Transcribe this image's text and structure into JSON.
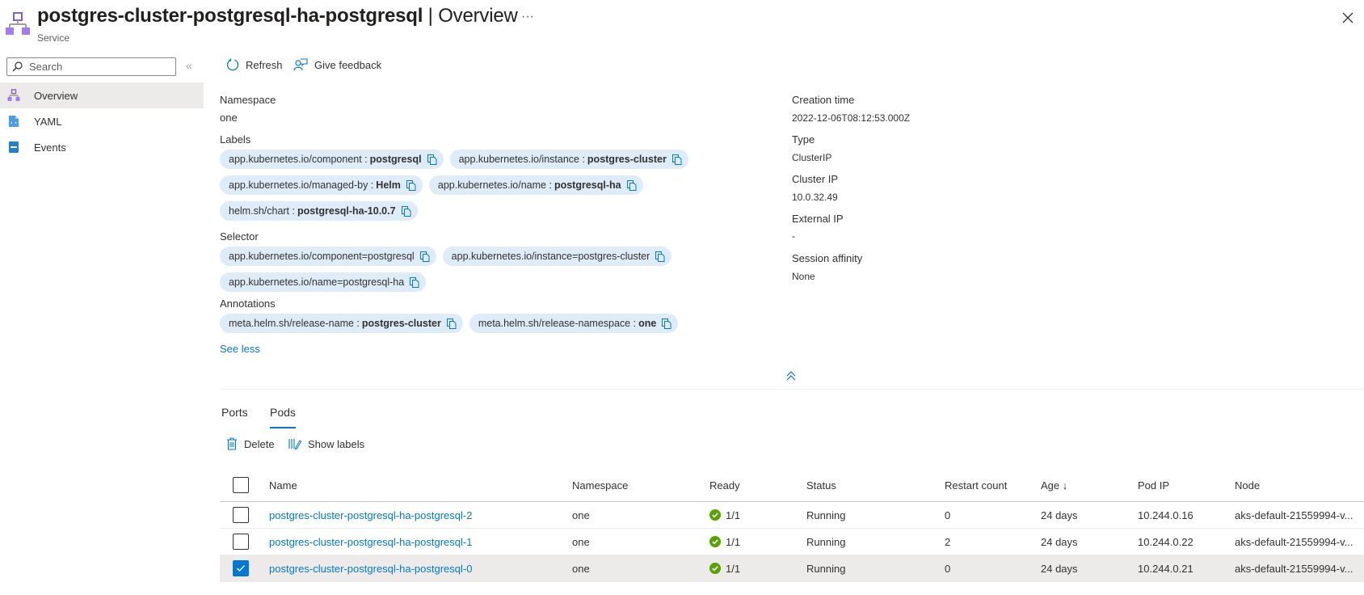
{
  "header": {
    "title": "postgres-cluster-postgresql-ha-postgresql",
    "separator": " | ",
    "section": "Overview",
    "subtitle": "Service",
    "more_label": "···",
    "icon": "service-icon"
  },
  "sidebar": {
    "search_placeholder": "Search",
    "collapse_label": "«",
    "items": [
      {
        "label": "Overview",
        "icon": "service-icon",
        "active": true
      },
      {
        "label": "YAML",
        "icon": "yaml-file-icon",
        "active": false
      },
      {
        "label": "Events",
        "icon": "events-icon",
        "active": false
      }
    ]
  },
  "toolbar": {
    "refresh_label": "Refresh",
    "feedback_label": "Give feedback"
  },
  "properties": {
    "namespace_label": "Namespace",
    "namespace_value": "one",
    "labels_label": "Labels",
    "labels": [
      {
        "key": "app.kubernetes.io/component :",
        "value": "postgresql"
      },
      {
        "key": "app.kubernetes.io/instance :",
        "value": "postgres-cluster"
      },
      {
        "key": "app.kubernetes.io/managed-by :",
        "value": "Helm"
      },
      {
        "key": "app.kubernetes.io/name :",
        "value": "postgresql-ha"
      },
      {
        "key": "helm.sh/chart :",
        "value": "postgresql-ha-10.0.7"
      }
    ],
    "selector_label": "Selector",
    "selectors": [
      "app.kubernetes.io/component=postgresql",
      "app.kubernetes.io/instance=postgres-cluster",
      "app.kubernetes.io/name=postgresql-ha"
    ],
    "annotations_label": "Annotations",
    "annotations": [
      {
        "key": "meta.helm.sh/release-name :",
        "value": "postgres-cluster"
      },
      {
        "key": "meta.helm.sh/release-namespace :",
        "value": "one"
      }
    ],
    "see_less_label": "See less",
    "creation_time_label": "Creation time",
    "creation_time_value": "2022-12-06T08:12:53.000Z",
    "type_label": "Type",
    "type_value": "ClusterIP",
    "cluster_ip_label": "Cluster IP",
    "cluster_ip_value": "10.0.32.49",
    "external_ip_label": "External IP",
    "external_ip_value": "-",
    "session_affinity_label": "Session affinity",
    "session_affinity_value": "None"
  },
  "tabs": [
    {
      "label": "Ports",
      "active": false
    },
    {
      "label": "Pods",
      "active": true
    }
  ],
  "pods_toolbar": {
    "delete_label": "Delete",
    "show_labels_label": "Show labels"
  },
  "table": {
    "columns": [
      "Name",
      "Namespace",
      "Ready",
      "Status",
      "Restart count",
      "Age ↓",
      "Pod IP",
      "Node"
    ],
    "rows": [
      {
        "name": "postgres-cluster-postgresql-ha-postgresql-2",
        "namespace": "one",
        "ready": "1/1",
        "status": "Running",
        "restart_count": "0",
        "age": "24 days",
        "pod_ip": "10.244.0.16",
        "node": "aks-default-21559994-v...",
        "selected": false
      },
      {
        "name": "postgres-cluster-postgresql-ha-postgresql-1",
        "namespace": "one",
        "ready": "1/1",
        "status": "Running",
        "restart_count": "2",
        "age": "24 days",
        "pod_ip": "10.244.0.22",
        "node": "aks-default-21559994-v...",
        "selected": false
      },
      {
        "name": "postgres-cluster-postgresql-ha-postgresql-0",
        "namespace": "one",
        "ready": "1/1",
        "status": "Running",
        "restart_count": "0",
        "age": "24 days",
        "pod_ip": "10.244.0.21",
        "node": "aks-default-21559994-v...",
        "selected": true
      }
    ]
  },
  "colors": {
    "accent": "#0078d4",
    "chip_bg": "#deecf9",
    "ready_green": "#57a300",
    "selected_row": "#edebe9",
    "service_icon_purple": "#a67af4"
  }
}
